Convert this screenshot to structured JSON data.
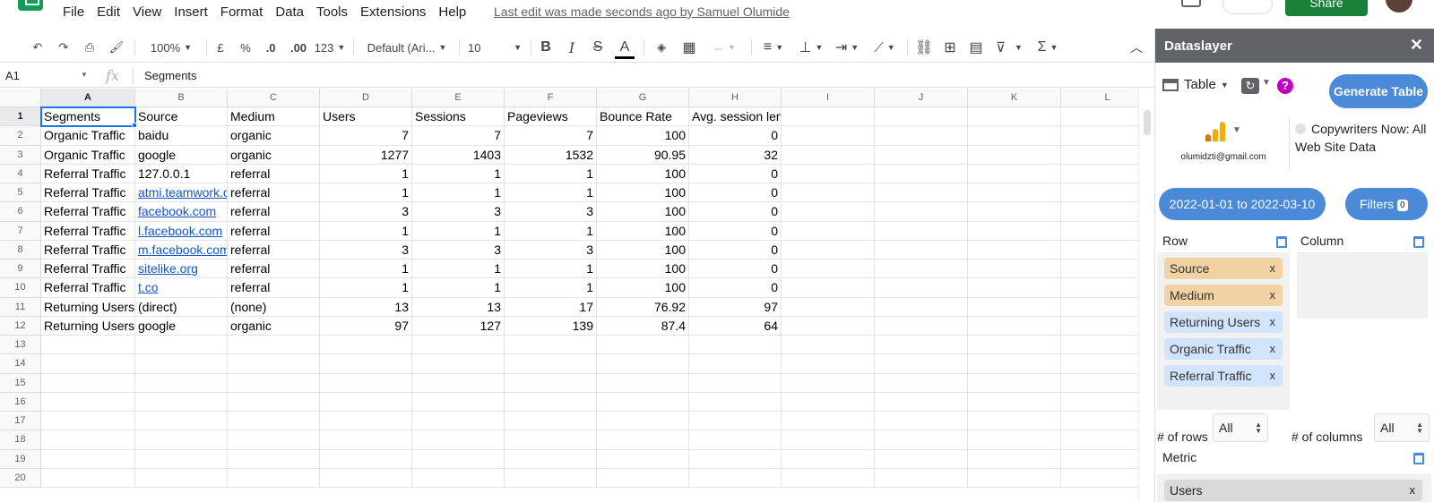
{
  "menubar": {
    "items": [
      "File",
      "Edit",
      "View",
      "Insert",
      "Format",
      "Data",
      "Tools",
      "Extensions",
      "Help"
    ],
    "last_edit": "Last edit was made seconds ago by Samuel Olumide",
    "share_label": "Share"
  },
  "toolbar": {
    "zoom": "100%",
    "currency": "£",
    "percent": "%",
    "decrease_decimal": ".0",
    "increase_decimal": ".00",
    "number_format": "123",
    "font": "Default (Ari...",
    "font_size": "10"
  },
  "formula_bar": {
    "name_box": "A1",
    "fx": "fx",
    "value": "Segments"
  },
  "sheet": {
    "columns": [
      "A",
      "B",
      "C",
      "D",
      "E",
      "F",
      "G",
      "H",
      "I",
      "J",
      "K",
      "L"
    ],
    "row_numbers": [
      "1",
      "2",
      "3",
      "4",
      "5",
      "6",
      "7",
      "8",
      "9",
      "10",
      "11",
      "12",
      "13",
      "14",
      "15",
      "16",
      "17",
      "18",
      "19",
      "20"
    ],
    "headers": [
      "Segments",
      "Source",
      "Medium",
      "Users",
      "Sessions",
      "Pageviews",
      "Bounce Rate",
      "Avg. session length (seconds)"
    ],
    "rows": [
      [
        "Organic Traffic",
        "baidu",
        "organic",
        "7",
        "7",
        "7",
        "100",
        "0"
      ],
      [
        "Organic Traffic",
        "google",
        "organic",
        "1277",
        "1403",
        "1532",
        "90.95",
        "32"
      ],
      [
        "Referral Traffic",
        "127.0.0.1",
        "referral",
        "1",
        "1",
        "1",
        "100",
        "0"
      ],
      [
        "Referral Traffic",
        "atmi.teamwork.c",
        "referral",
        "1",
        "1",
        "1",
        "100",
        "0"
      ],
      [
        "Referral Traffic",
        "facebook.com",
        "referral",
        "3",
        "3",
        "3",
        "100",
        "0"
      ],
      [
        "Referral Traffic",
        "l.facebook.com",
        "referral",
        "1",
        "1",
        "1",
        "100",
        "0"
      ],
      [
        "Referral Traffic",
        "m.facebook.com",
        "referral",
        "3",
        "3",
        "3",
        "100",
        "0"
      ],
      [
        "Referral Traffic",
        "sitelike.org",
        "referral",
        "1",
        "1",
        "1",
        "100",
        "0"
      ],
      [
        "Referral Traffic",
        "t.co",
        "referral",
        "1",
        "1",
        "1",
        "100",
        "0"
      ],
      [
        "Returning Users",
        "(direct)",
        "(none)",
        "13",
        "13",
        "17",
        "76.92",
        "97"
      ],
      [
        "Returning Users",
        "google",
        "organic",
        "97",
        "127",
        "139",
        "87.4",
        "64"
      ]
    ],
    "link_cells": [
      [
        3,
        1
      ],
      [
        4,
        1
      ],
      [
        5,
        1
      ],
      [
        6,
        1
      ],
      [
        7,
        1
      ],
      [
        8,
        1
      ]
    ]
  },
  "panel": {
    "title": "Dataslayer",
    "close": "✕",
    "table_label": "Table",
    "help": "?",
    "generate_label": "Generate Table",
    "account_email": "olumidzti@gmail.com",
    "site_name": "Copywriters Now: All Web Site Data",
    "date_range": "2022-01-01 to 2022-03-10",
    "filters_label": "Filters",
    "filters_count": "0",
    "row_label": "Row",
    "column_label": "Column",
    "row_chips": [
      {
        "label": "Source",
        "kind": "dim"
      },
      {
        "label": "Medium",
        "kind": "dim"
      },
      {
        "label": "Returning Users",
        "kind": "seg"
      },
      {
        "label": "Organic Traffic",
        "kind": "seg"
      },
      {
        "label": "Referral Traffic",
        "kind": "seg"
      }
    ],
    "chip_remove": "x",
    "rows_count_label": "# of rows",
    "rows_count_value": "All",
    "cols_count_label": "# of columns",
    "cols_count_value": "All",
    "metric_label": "Metric",
    "metric_chip": "Users",
    "ga_colors": [
      "#f9ab00",
      "#e37400"
    ],
    "accent": "#4a8ad8",
    "dimension_chip_color": "#f1d3a3",
    "segment_chip_color": "#d2e3fc"
  }
}
